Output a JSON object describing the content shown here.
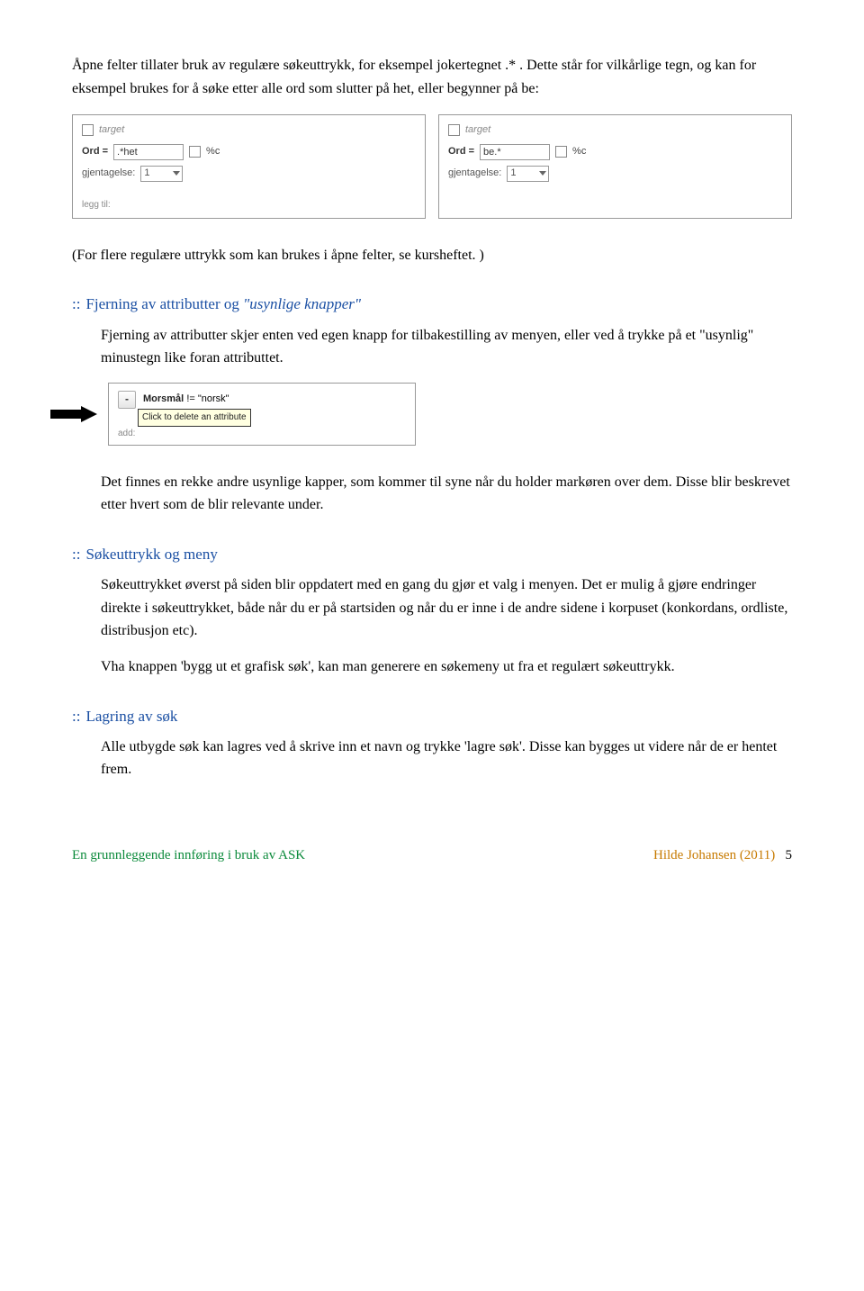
{
  "intro": {
    "p1": "Åpne felter tillater bruk av regulære søkeuttrykk, for eksempel jokertegnet .* . Dette står for vilkårlige tegn, og kan for eksempel brukes for å søke etter alle ord som slutter på het,  eller begynner på be:"
  },
  "panels": {
    "left": {
      "target": "target",
      "ord_label": "Ord =",
      "ord_value": ".*het",
      "percent_c": "%c",
      "gjentagelse_label": "gjentagelse:",
      "gjentagelse_value": "1",
      "legg_til": "legg til:"
    },
    "right": {
      "target": "target",
      "ord_label": "Ord =",
      "ord_value": "be.*",
      "percent_c": "%c",
      "gjentagelse_label": "gjentagelse:",
      "gjentagelse_value": "1"
    }
  },
  "note_after_panels": "(For flere regulære uttrykk som kan brukes i åpne felter, se kursheftet. )",
  "sections": {
    "fjerning": {
      "colon": "::",
      "title_plain": "Fjerning av attributter og ",
      "title_ital": "\"usynlige knapper\"",
      "p1": "Fjerning av attributter skjer enten ved egen knapp for tilbakestilling av menyen, eller ved å trykke på et \"usynlig\" minustegn like foran attributtet.",
      "delete_panel": {
        "morsmal": "Morsmål",
        "op": "!=",
        "value": "\"norsk\"",
        "tooltip": "Click to delete an attribute",
        "add": "add:"
      },
      "p2": "Det finnes en rekke andre usynlige kapper, som kommer til syne når du holder markøren over dem. Disse blir beskrevet etter hvert som de blir relevante under."
    },
    "sokeuttrykk": {
      "colon": "::",
      "title": "Søkeuttrykk og meny",
      "p1": "Søkeuttrykket øverst på siden blir oppdatert med en gang du gjør et valg i menyen. Det er mulig å gjøre endringer direkte i søkeuttrykket, både når du er på startsiden og når du er inne i de andre sidene i korpuset (konkordans, ordliste, distribusjon etc).",
      "p2": "Vha knappen 'bygg ut et grafisk søk', kan man generere en søkemeny ut fra et regulært søkeuttrykk."
    },
    "lagring": {
      "colon": "::",
      "title": "Lagring av søk",
      "p1": "Alle utbygde søk kan lagres ved å skrive inn et navn og trykke 'lagre søk'. Disse kan bygges ut videre når de er hentet frem."
    }
  },
  "footer": {
    "left": "En grunnleggende innføring i bruk av ASK",
    "right_author": "Hilde Johansen (2011)",
    "page": "5"
  }
}
